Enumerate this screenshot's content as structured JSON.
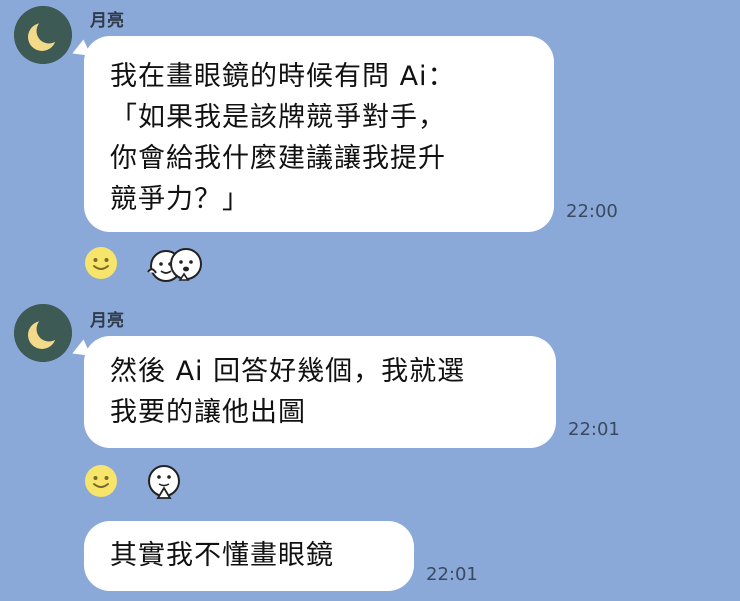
{
  "messages": [
    {
      "sender": "月亮",
      "lines": [
        "我在畫眼鏡的時候有問 Ai：",
        "「如果我是該牌競爭對手，",
        "你會給我什麼建議讓我提升",
        "競爭力？」"
      ],
      "time": "22:00",
      "avatar_icon": "crescent-moon-icon"
    },
    {
      "sender": "月亮",
      "lines": [
        "然後 Ai 回答好幾個，我就選",
        "我要的讓他出圖"
      ],
      "time": "22:01",
      "avatar_icon": "crescent-moon-icon"
    },
    {
      "lines": [
        "其實我不懂畫眼鏡"
      ],
      "time": "22:01"
    }
  ],
  "reactions": [
    {
      "emoji_icon": "smiley-face-icon",
      "sticker_icon": "two-characters-sticker-icon"
    },
    {
      "emoji_icon": "smiley-face-icon",
      "sticker_icon": "hands-clasped-character-sticker-icon"
    }
  ],
  "colors": {
    "background": "#8ba9d8",
    "bubble": "#ffffff",
    "avatar": "#3e5a55",
    "moon": "#f3d98a"
  }
}
